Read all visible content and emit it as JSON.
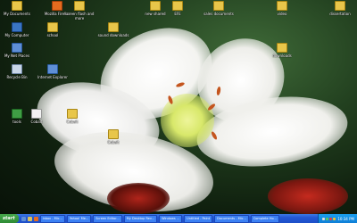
{
  "desktop_icons": [
    {
      "label": "My Documents",
      "icon": "folder-icon"
    },
    {
      "label": "Mozilla Firefox",
      "icon": "firefox-icon"
    },
    {
      "label": "screen flash and more",
      "icon": "folder-icon"
    },
    {
      "label": "new shared",
      "icon": "folder-icon"
    },
    {
      "label": "EFE",
      "icon": "folder-icon"
    },
    {
      "label": "sales documents",
      "icon": "folder-icon"
    },
    {
      "label": "video",
      "icon": "folder-icon"
    },
    {
      "label": "dissertation",
      "icon": "folder-icon"
    },
    {
      "label": "My Computer",
      "icon": "computer-icon"
    },
    {
      "label": "school",
      "icon": "folder-icon"
    },
    {
      "label": "sound downloads",
      "icon": "folder-icon"
    },
    {
      "label": "My Net Places",
      "icon": "network-icon"
    },
    {
      "label": "Recycle Bin",
      "icon": "recycle-bin-icon"
    },
    {
      "label": "Internet Explorer",
      "icon": "ie-icon"
    },
    {
      "label": "downloads",
      "icon": "folder-icon"
    },
    {
      "label": "tools",
      "icon": "folder-icon"
    },
    {
      "label": "Cobalt",
      "icon": "folder-icon"
    },
    {
      "label": "Cobalt",
      "icon": "folder-icon"
    },
    {
      "label": "Cobalt",
      "icon": "folder-icon"
    }
  ],
  "taskbar": {
    "start_label": "start",
    "tasks": [
      "inbox - Mic...",
      "Yahoo! Me...",
      "Screen Editor...",
      "My Desktop Rev...",
      "Windows ...",
      "Untitled - Paint",
      "Documents - Mic...",
      "Complete Ho..."
    ],
    "clock": "10:34 PM"
  },
  "colors": {
    "taskbar": "#2257d4",
    "start": "#2e8b34",
    "tray": "#0f7ed6"
  }
}
